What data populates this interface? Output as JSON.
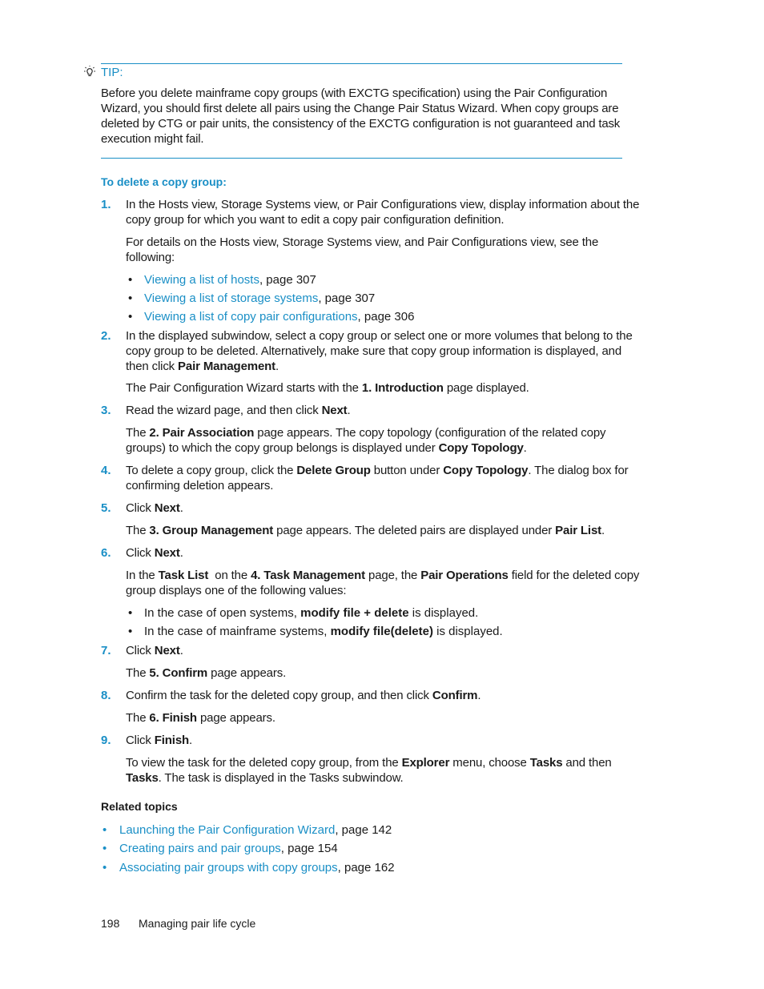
{
  "tip": {
    "icon": "lightbulb-icon",
    "label": "TIP:",
    "text": "Before you delete mainframe copy groups (with EXCTG specification) using the Pair Configuration Wizard, you should first delete all pairs using the Change Pair Status Wizard. When copy groups are deleted by CTG or pair units, the consistency of the EXCTG configuration is not guaranteed and task execution might fail."
  },
  "procedure_title": "To delete a copy group:",
  "steps": [
    {
      "num": "1.",
      "text": "In the Hosts view, Storage Systems view, or Pair Configurations view, display information about the copy group for which you want to edit a copy pair configuration definition.",
      "note": "For details on the Hosts view, Storage Systems view, and Pair Configurations view, see the following:",
      "links": [
        {
          "link": "Viewing a list of hosts",
          "suffix": ", page 307"
        },
        {
          "link": "Viewing a list of storage systems",
          "suffix": ", page 307"
        },
        {
          "link": "Viewing a list of copy pair configurations",
          "suffix": ", page 306"
        }
      ]
    },
    {
      "num": "2.",
      "text_a": "In the displayed subwindow, select a copy group or select one or more volumes that belong to the copy group to be deleted. Alternatively, make sure that copy group information is displayed, and then click ",
      "bold_a": "Pair Management",
      "text_b": ".",
      "note_a": "The Pair Configuration Wizard starts with the ",
      "note_bold": "1. Introduction",
      "note_b": " page displayed."
    },
    {
      "num": "3.",
      "text_a": "Read the wizard page, and then click ",
      "bold_a": "Next",
      "text_b": ".",
      "note_a": "The ",
      "note_bold": "2. Pair Association",
      "note_b": " page appears. The copy topology (configuration of the related copy groups) to which the copy group belongs is displayed under ",
      "note_bold2": "Copy Topology",
      "note_c": "."
    },
    {
      "num": "4.",
      "text_a": "To delete a copy group, click the ",
      "bold_a": "Delete Group",
      "text_b": " button under ",
      "bold_b": "Copy Topology",
      "text_c": ". The dialog box for confirming deletion appears."
    },
    {
      "num": "5.",
      "text_a": "Click ",
      "bold_a": "Next",
      "text_b": ".",
      "note_a": "The ",
      "note_bold": "3. Group Management",
      "note_b": " page appears. The deleted pairs are displayed under ",
      "note_bold2": "Pair List",
      "note_c": "."
    },
    {
      "num": "6.",
      "text_a": "Click ",
      "bold_a": "Next",
      "text_b": ".",
      "note_a": "In the ",
      "note_bold": "Task List",
      "note_b": "  on the ",
      "note_bold2": "4. Task Management",
      "note_c": " page, the ",
      "note_bold3": "Pair Operations",
      "note_d": " field for the deleted copy group displays one of the following values:",
      "bullets": [
        {
          "a": "In the case of open systems, ",
          "bold": "modify file + delete",
          "b": " is displayed."
        },
        {
          "a": "In the case of mainframe systems, ",
          "bold": "modify file(delete)",
          "b": " is displayed."
        }
      ]
    },
    {
      "num": "7.",
      "text_a": "Click ",
      "bold_a": "Next",
      "text_b": ".",
      "note_a": "The ",
      "note_bold": "5. Confirm",
      "note_b": " page appears."
    },
    {
      "num": "8.",
      "text_a": "Confirm the task for the deleted copy group, and then click ",
      "bold_a": "Confirm",
      "text_b": ".",
      "note_a": "The ",
      "note_bold": "6. Finish",
      "note_b": " page appears."
    },
    {
      "num": "9.",
      "text_a": "Click ",
      "bold_a": "Finish",
      "text_b": ".",
      "note_a": "To view the task for the deleted copy group, from the ",
      "note_bold": "Explorer",
      "note_b": " menu, choose ",
      "note_bold2": "Tasks",
      "note_c": " and then ",
      "note_bold3": "Tasks",
      "note_d": ". The task is displayed in the Tasks subwindow."
    }
  ],
  "related": {
    "title": "Related topics",
    "items": [
      {
        "link": "Launching the Pair Configuration Wizard",
        "suffix": ", page 142"
      },
      {
        "link": "Creating pairs and pair groups",
        "suffix": ", page 154"
      },
      {
        "link": "Associating pair groups with copy groups",
        "suffix": ", page 162"
      }
    ]
  },
  "footer": {
    "page_number": "198",
    "section": "Managing pair life cycle"
  },
  "colors": {
    "accent": "#1a8fc6",
    "text": "#1a1a1a"
  }
}
